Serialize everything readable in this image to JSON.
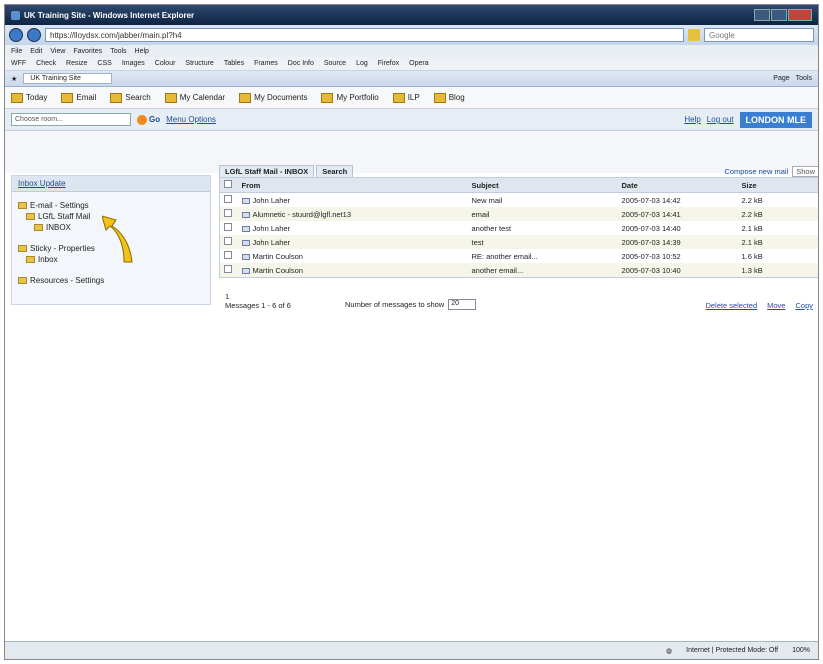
{
  "window": {
    "title": "UK Training Site - Windows Internet Explorer",
    "address": "https://lloydsx.com/jabber/main.pl?h4",
    "search_placeholder": "Google"
  },
  "menubar": [
    "File",
    "Edit",
    "View",
    "Favorites",
    "Tools",
    "Help"
  ],
  "toolbar1": [
    "WFF",
    "Check",
    "Resize",
    "CSS",
    "Images",
    "Colour",
    "Structure",
    "Tables",
    "Frames",
    "Doc Info",
    "Source",
    "Log",
    "Firefox",
    "Opera"
  ],
  "browser_tab": {
    "label": "UK Training Site"
  },
  "tabrow_right": [
    "Page",
    "Tools"
  ],
  "portal_nav": [
    "Today",
    "Email",
    "Search",
    "My Calendar",
    "My Documents",
    "My Portfolio",
    "ILP",
    "Blog"
  ],
  "choose": {
    "placeholder": "Choose room...",
    "go": "Go",
    "link": "Menu Options"
  },
  "header_right": {
    "help": "Help",
    "logout": "Log out",
    "brand": "LONDON MLE"
  },
  "left": {
    "header": "Inbox Update",
    "tree": [
      {
        "label": "E-mail - Settings",
        "level": 0
      },
      {
        "label": "LGfL Staff Mail",
        "level": 1
      },
      {
        "label": "INBOX",
        "level": 2
      },
      {
        "label": "Sticky - Properties",
        "level": 0
      },
      {
        "label": "Inbox",
        "level": 1
      },
      {
        "label": "Resources - Settings",
        "level": 0
      }
    ]
  },
  "mail": {
    "tab_active": "LGfL Staff Mail - INBOX",
    "tab_search": "Search",
    "compose": "Compose new mail",
    "show": "Show",
    "columns": [
      "From",
      "Subject",
      "Date",
      "Size"
    ],
    "rows": [
      {
        "from": "John Laher",
        "subject": "New mail",
        "date": "2005-07-03 14:42",
        "size": "2.2 kB"
      },
      {
        "from": "Alumnetic - stuurd@lgfl.net13",
        "subject": "email",
        "date": "2005-07-03 14:41",
        "size": "2.2 kB"
      },
      {
        "from": "John Laher",
        "subject": "another test",
        "date": "2005-07-03 14:40",
        "size": "2.1 kB"
      },
      {
        "from": "John Laher",
        "subject": "test",
        "date": "2005-07-03 14:39",
        "size": "2.1 kB"
      },
      {
        "from": "Martin Coulson",
        "subject": "RE: another email...",
        "date": "2005-07-03 10:52",
        "size": "1.6 kB"
      },
      {
        "from": "Martin Coulson",
        "subject": "another email...",
        "date": "2005-07-03 10:40",
        "size": "1.3 kB"
      }
    ],
    "page_num": "1",
    "messages": "Messages 1 - 6 of 6",
    "num_label": "Number of messages to show",
    "num_value": "20",
    "actions": [
      "Delete selected",
      "Move",
      "Copy"
    ]
  },
  "status": {
    "zone": "Internet | Protected Mode: Off",
    "zoom": "100%"
  },
  "colors": {
    "accent": "#1b4e9b",
    "arrow": "#f2c21a"
  }
}
